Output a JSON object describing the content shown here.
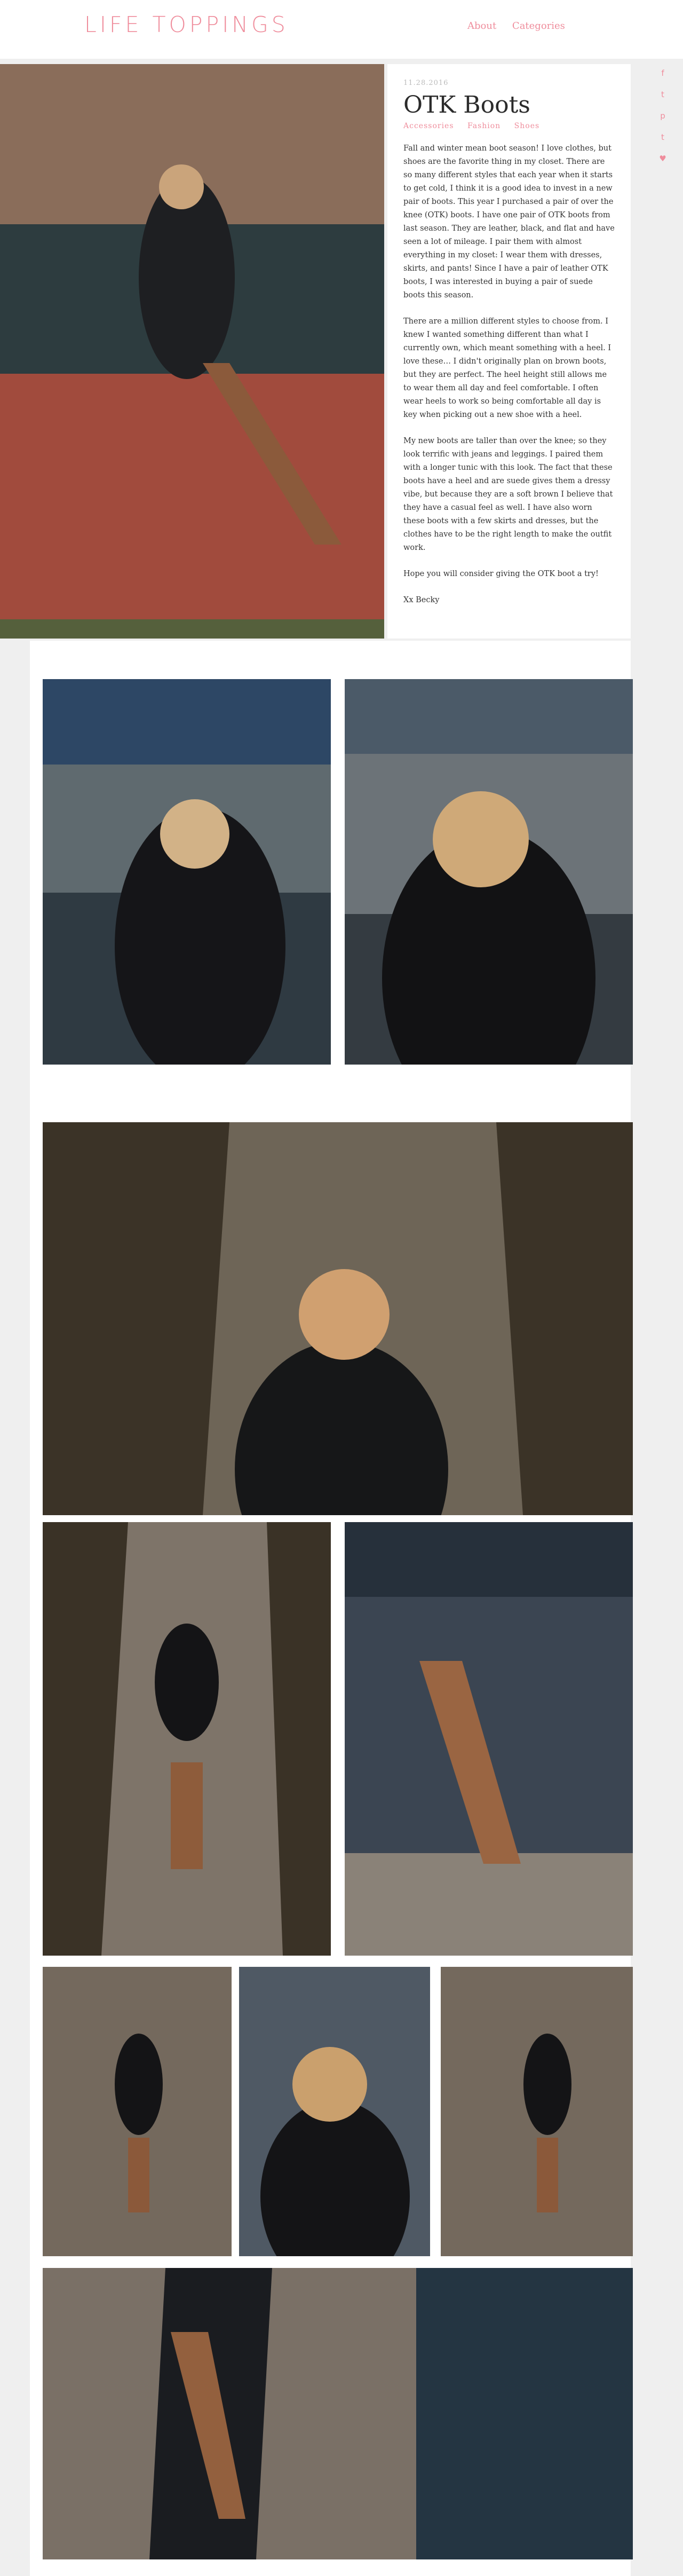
{
  "site": {
    "logo": "LIFE TOPPINGS"
  },
  "nav": {
    "about": "About",
    "categories": "Categories"
  },
  "social": [
    "f",
    "t",
    "p",
    "t",
    "♥"
  ],
  "post": {
    "date": "11.28.2016",
    "title": "OTK Boots",
    "tags": [
      "Accessories",
      "Fashion",
      "Shoes"
    ],
    "paragraphs": [
      "Fall and winter mean boot season! I love clothes, but shoes are the favorite thing in my closet. There are so many different styles that each year when it starts to get cold, I think it is a good idea to invest in a new pair of boots. This year I purchased a pair of over the knee (OTK) boots. I have one pair of OTK boots from last season. They are leather, black, and flat and have seen a lot of mileage. I pair them with almost everything in my closet: I wear them with dresses, skirts, and pants! Since I have a pair of leather OTK boots, I was interested in buying a pair of suede boots this season.",
      "There are a million different styles to choose from. I knew I wanted something different than what I currently own, which meant something with a heel. I love these… I didn't originally plan on brown boots, but they are perfect. The heel height still allows me to wear them all day and feel comfortable. I often wear heels to work so being comfortable all day is key when picking out a new shoe with a heel.",
      "My new boots are taller than over the knee; so they look terrific with jeans and leggings. I paired them with a longer tunic with this look. The fact that these boots have a heel and are suede gives them a dressy vibe, but because they are a soft brown I believe that they have a casual feel as well. I have also worn these boots with a few skirts and dresses, but the clothes have to be the right length to make the outfit work.",
      "Hope you will consider giving the OTK boot a try!",
      "Xx Becky"
    ]
  },
  "colors": {
    "accent": "#ef8d9c"
  }
}
